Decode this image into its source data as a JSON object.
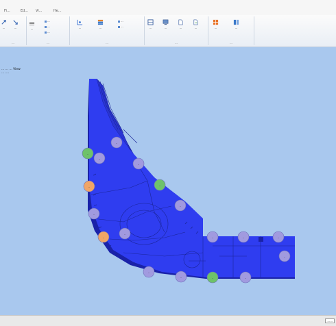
{
  "menu": {
    "items": [
      "Fi...",
      "Ed...",
      "Vi...",
      "He..."
    ]
  },
  "ribbon": {
    "groups": [
      {
        "label": "..."
      },
      {
        "label": "..."
      },
      {
        "label": "..."
      },
      {
        "label": "..."
      },
      {
        "label": "..."
      }
    ],
    "buttons": [
      "...",
      "...",
      "...",
      "...",
      "...",
      "...",
      "...",
      "...",
      "...",
      "...",
      "...",
      "...",
      "..."
    ],
    "small_items": [
      "...",
      "...",
      "...",
      "...",
      "..."
    ]
  },
  "viewport": {
    "info_line1": "... ... ... View",
    "info_line2": "... ...."
  },
  "status": {
    "text": "......"
  },
  "colors": {
    "body": "#2f3df0",
    "body_dark": "#1a22a8",
    "node_purple": "#a19adf",
    "node_green": "#6ec26a",
    "node_orange": "#f0a566",
    "background": "#a9c8ee"
  },
  "nodes": [
    {
      "type": "purple"
    },
    {
      "type": "purple"
    },
    {
      "type": "green"
    },
    {
      "type": "purple"
    },
    {
      "type": "orange"
    },
    {
      "type": "green"
    },
    {
      "type": "purple"
    },
    {
      "type": "purple"
    },
    {
      "type": "orange"
    },
    {
      "type": "purple"
    },
    {
      "type": "purple"
    },
    {
      "type": "purple"
    },
    {
      "type": "purple"
    },
    {
      "type": "purple"
    },
    {
      "type": "purple"
    },
    {
      "type": "purple"
    },
    {
      "type": "green"
    },
    {
      "type": "purple"
    }
  ]
}
